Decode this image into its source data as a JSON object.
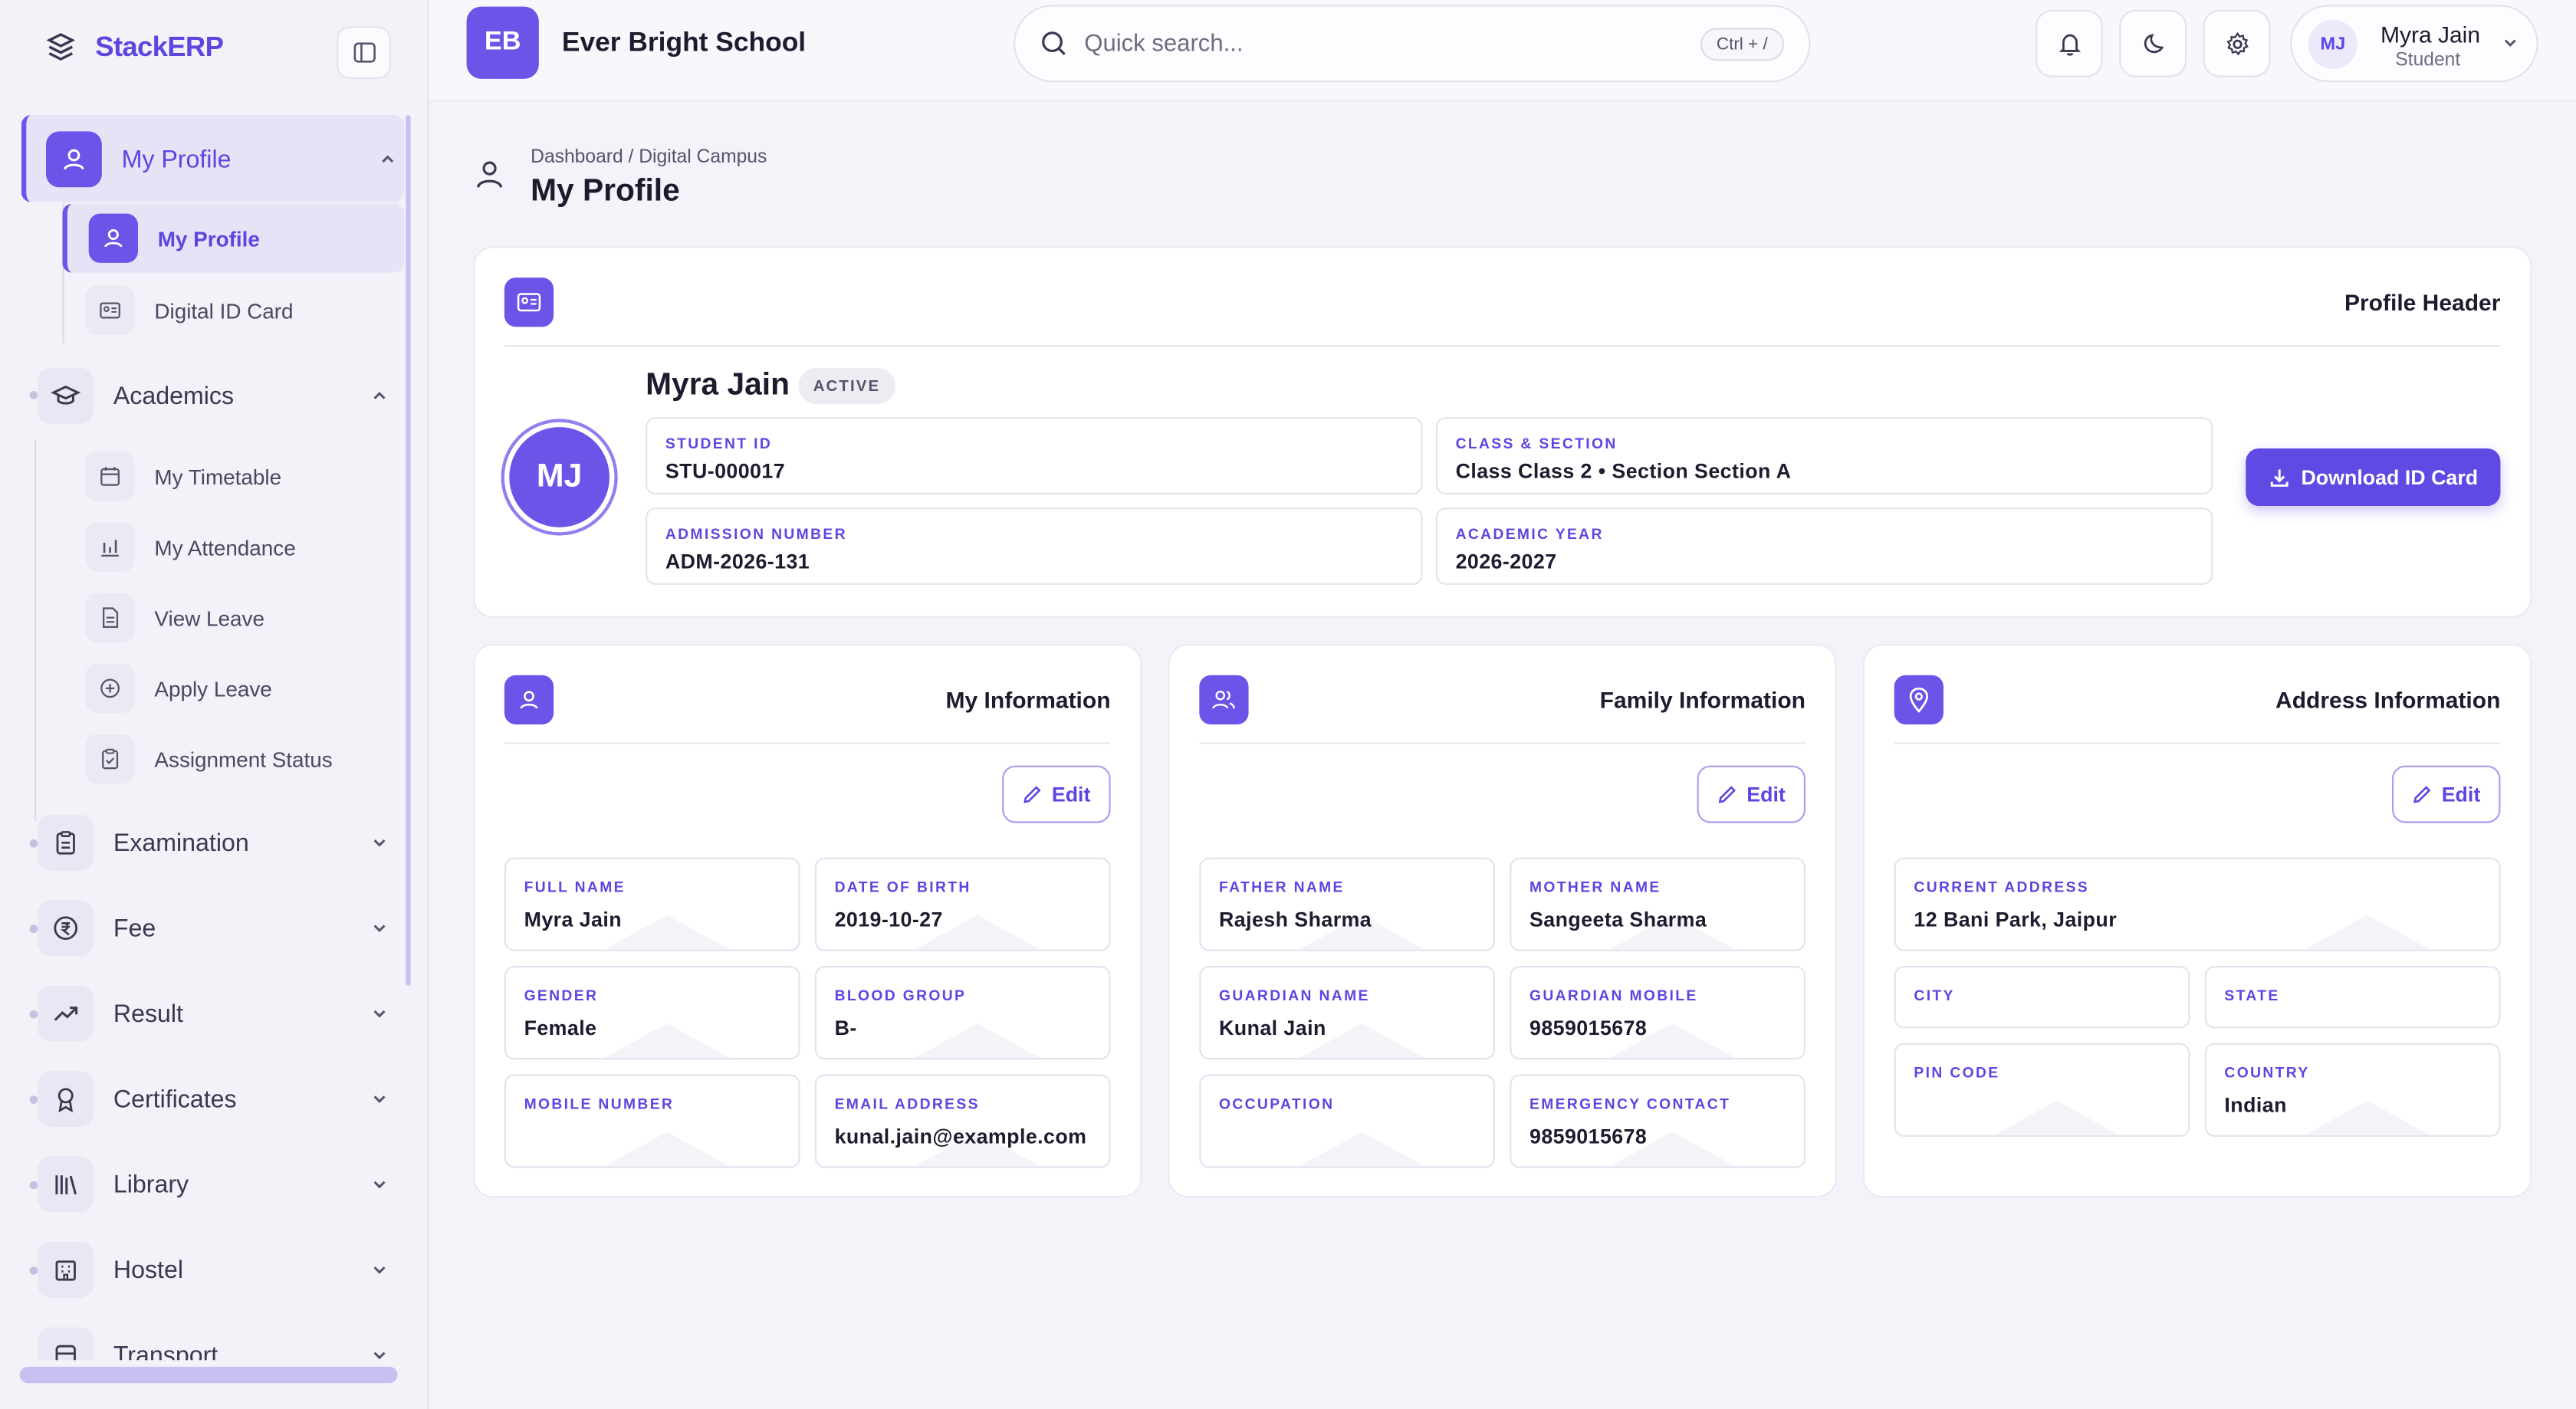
{
  "brand": {
    "name": "StackERP"
  },
  "sidebar": {
    "groups": [
      {
        "label": "My Profile",
        "expanded": true,
        "children": [
          "My Profile",
          "Digital ID Card"
        ]
      },
      {
        "label": "Academics",
        "expanded": true,
        "children": [
          "My Timetable",
          "My Attendance",
          "View Leave",
          "Apply Leave",
          "Assignment Status"
        ]
      },
      {
        "label": "Examination"
      },
      {
        "label": "Fee"
      },
      {
        "label": "Result"
      },
      {
        "label": "Certificates"
      },
      {
        "label": "Library"
      },
      {
        "label": "Hostel"
      },
      {
        "label": "Transport"
      }
    ]
  },
  "topbar": {
    "school_initials": "EB",
    "school_name": "Ever Bright School",
    "search_placeholder": "Quick search...",
    "search_shortcut": "Ctrl + /",
    "user": {
      "initials": "MJ",
      "name": "Myra Jain",
      "role": "Student"
    }
  },
  "page": {
    "breadcrumb": "Dashboard / Digital Campus",
    "title": "My Profile"
  },
  "profile_header": {
    "title": "Profile Header",
    "initials": "MJ",
    "name": "Myra Jain",
    "status": "ACTIVE",
    "fields": {
      "student_id": {
        "label": "STUDENT ID",
        "value": "STU-000017"
      },
      "class_section": {
        "label": "CLASS & SECTION",
        "value": "Class Class 2 • Section Section A"
      },
      "admission_number": {
        "label": "ADMISSION NUMBER",
        "value": "ADM-2026-131"
      },
      "academic_year": {
        "label": "ACADEMIC YEAR",
        "value": "2026-2027"
      }
    },
    "download_label": "Download ID Card"
  },
  "my_information": {
    "title": "My Information",
    "edit_label": "Edit",
    "fields": [
      {
        "label": "FULL NAME",
        "value": "Myra Jain"
      },
      {
        "label": "DATE OF BIRTH",
        "value": "2019-10-27"
      },
      {
        "label": "GENDER",
        "value": "Female"
      },
      {
        "label": "BLOOD GROUP",
        "value": "B-"
      },
      {
        "label": "MOBILE NUMBER",
        "value": ""
      },
      {
        "label": "EMAIL ADDRESS",
        "value": "kunal.jain@example.com"
      }
    ]
  },
  "family_information": {
    "title": "Family Information",
    "edit_label": "Edit",
    "fields": [
      {
        "label": "FATHER NAME",
        "value": "Rajesh Sharma"
      },
      {
        "label": "MOTHER NAME",
        "value": "Sangeeta Sharma"
      },
      {
        "label": "GUARDIAN NAME",
        "value": "Kunal Jain"
      },
      {
        "label": "GUARDIAN MOBILE",
        "value": "9859015678"
      },
      {
        "label": "OCCUPATION",
        "value": ""
      },
      {
        "label": "EMERGENCY CONTACT",
        "value": "9859015678"
      }
    ]
  },
  "address_information": {
    "title": "Address Information",
    "edit_label": "Edit",
    "fields": [
      {
        "label": "CURRENT ADDRESS",
        "value": "12 Bani Park, Jaipur"
      },
      {
        "label": "CITY",
        "value": ""
      },
      {
        "label": "STATE",
        "value": ""
      },
      {
        "label": "PIN CODE",
        "value": ""
      },
      {
        "label": "COUNTRY",
        "value": "Indian"
      }
    ]
  },
  "colors": {
    "accent": "#6a55e8",
    "accent_dark": "#5b47e0"
  }
}
